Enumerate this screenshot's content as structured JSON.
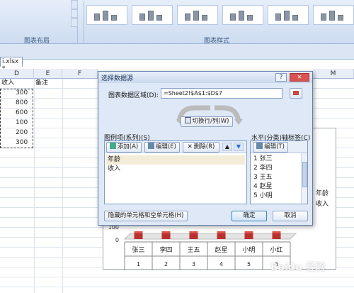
{
  "ribbon": {
    "group_layout_label": "图表布局",
    "group_style_label": "图表样式"
  },
  "file_tab": "i.xlsx *",
  "columns": [
    "D",
    "E",
    "F",
    "M"
  ],
  "sheet": {
    "header_row": [
      "收入",
      "备注"
    ],
    "values": [
      "300",
      "800",
      "600",
      "100",
      "200",
      "300"
    ]
  },
  "chart_data": {
    "type": "bar",
    "categories": [
      "张三",
      "李四",
      "王五",
      "赵星",
      "小明",
      "小红"
    ],
    "category_numbers": [
      "1",
      "2",
      "3",
      "4",
      "5",
      "6"
    ],
    "series": [
      {
        "name": "年龄",
        "values": [
          50,
          50,
          50,
          50,
          50,
          50
        ]
      },
      {
        "name": "收入",
        "values": [
          300,
          800,
          600,
          100,
          200,
          300
        ]
      }
    ],
    "y_ticks": [
      "100",
      "0"
    ],
    "legend": [
      "年龄",
      "收入"
    ],
    "colors": {
      "bar": "#b8302f",
      "bar_top": "#d9534f"
    }
  },
  "dialog": {
    "title": "选择数据源",
    "help_btn": "?",
    "close_btn": "✕",
    "range_label": "图表数据区域(D):",
    "range_value": "=Sheet2!$A$1:$D$7",
    "switch_btn": "切换行/列(W)",
    "series_panel_label": "图例项(系列)(S)",
    "add_btn": "添加(A)",
    "edit_btn": "编辑(E)",
    "delete_btn": "删除(R)",
    "up_arrow": "▲",
    "down_arrow": "▼",
    "series_items": [
      "年龄",
      "收入"
    ],
    "axis_panel_label": "水平(分类)轴标签(C)",
    "axis_edit_btn": "编辑(T)",
    "axis_items": [
      "1 张三",
      "2 李四",
      "3 王五",
      "4 赵星",
      "5 小明"
    ],
    "hidden_cells_btn": "隐藏的单元格和空单元格(H)",
    "ok_btn": "确定",
    "cancel_btn": "取消"
  },
  "watermark": "Baidu 经验"
}
